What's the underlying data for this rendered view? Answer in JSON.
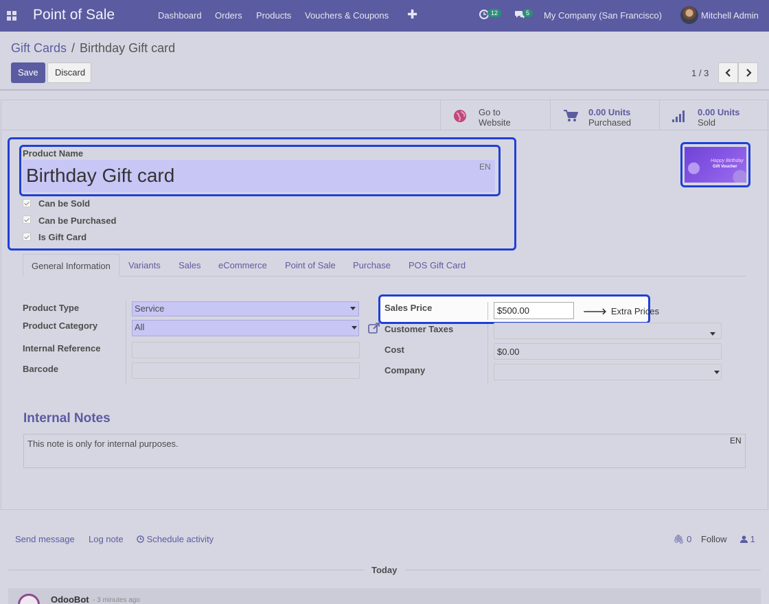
{
  "navbar": {
    "app_name": "Point of Sale",
    "menu": [
      "Dashboard",
      "Orders",
      "Products",
      "Vouchers & Coupons"
    ],
    "activity_count": "12",
    "message_count": "5",
    "company": "My Company (San Francisco)",
    "user": "Mitchell Admin"
  },
  "breadcrumb": {
    "parent": "Gift Cards",
    "separator": "/",
    "current": "Birthday Gift card"
  },
  "toolbar": {
    "save_label": "Save",
    "discard_label": "Discard",
    "pager": "1 / 3"
  },
  "smart_buttons": {
    "website": {
      "line1": "Go to",
      "line2": "Website"
    },
    "purchased": {
      "value": "0.00 Units",
      "label": "Purchased"
    },
    "sold": {
      "value": "0.00 Units",
      "label": "Sold"
    }
  },
  "product": {
    "name_label": "Product Name",
    "name": "Birthday Gift card",
    "lang": "EN",
    "checkboxes": [
      {
        "label": "Can be Sold",
        "checked": true
      },
      {
        "label": "Can be Purchased",
        "checked": true
      },
      {
        "label": "Is Gift Card",
        "checked": true
      }
    ],
    "image_text1": "Happy Birthday",
    "image_text2": "Gift Voucher"
  },
  "tabs": [
    "General Information",
    "Variants",
    "Sales",
    "eCommerce",
    "Point of Sale",
    "Purchase",
    "POS Gift Card"
  ],
  "general": {
    "product_type_label": "Product Type",
    "product_type": "Service",
    "product_category_label": "Product Category",
    "product_category": "All",
    "internal_reference_label": "Internal Reference",
    "internal_reference": "",
    "barcode_label": "Barcode",
    "barcode": "",
    "sales_price_label": "Sales Price",
    "sales_price": "$500.00",
    "extra_prices": "Extra Prices",
    "customer_taxes_label": "Customer Taxes",
    "customer_taxes": "",
    "cost_label": "Cost",
    "cost": "$0.00",
    "company_label": "Company",
    "company": ""
  },
  "notes": {
    "title": "Internal Notes",
    "text": "This note is only for internal purposes.",
    "lang": "EN"
  },
  "chatter": {
    "send_message": "Send message",
    "log_note": "Log note",
    "schedule_activity": "Schedule activity",
    "attachments": "0",
    "follow": "Follow",
    "followers": "1",
    "today": "Today",
    "author": "OdooBot",
    "time": "- 3 minutes ago"
  }
}
